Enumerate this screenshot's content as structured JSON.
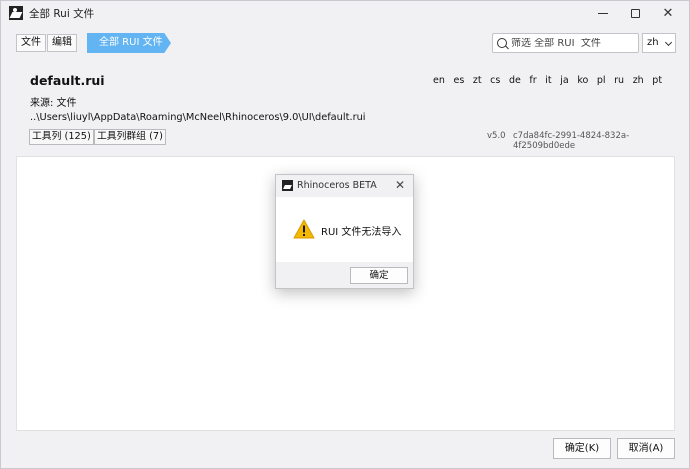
{
  "window": {
    "title": "全部 Rui 文件"
  },
  "toolbar": {
    "file_label": "文件",
    "edit_label": "编辑",
    "breadcrumb_label": "全部 RUI  文件",
    "search_placeholder": "筛选 全部 RUI  文件",
    "language_value": "zh"
  },
  "file": {
    "name": "default.rui",
    "languages": [
      "en",
      "es",
      "zt",
      "cs",
      "de",
      "fr",
      "it",
      "ja",
      "ko",
      "pl",
      "ru",
      "zh",
      "pt"
    ],
    "source": "来源: 文件",
    "path": "..\\Users\\liuyl\\AppData\\Roaming\\McNeel\\Rhinoceros\\9.0\\UI\\default.rui",
    "toolbars_label": "工具列 (125)",
    "groups_label": "工具列群组 (7)",
    "version": "v5.0",
    "guid": "c7da84fc-2991-4824-832a-4f2509bd0ede"
  },
  "footer": {
    "ok_label": "确定(K)",
    "cancel_label": "取消(A)"
  },
  "dialog": {
    "title": "Rhinoceros BETA",
    "message": "RUI 文件无法导入",
    "ok_label": "确定"
  },
  "colors": {
    "breadcrumb": "#63b4f2",
    "warning": "#f5b800"
  },
  "icons": {
    "app": "rhino-logo-icon",
    "search": "search-icon",
    "warning": "warning-icon"
  }
}
